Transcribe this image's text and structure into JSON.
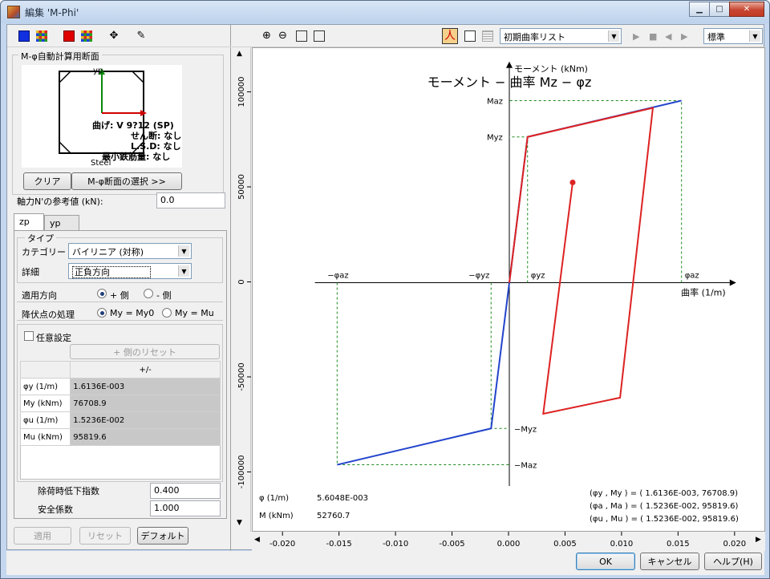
{
  "window": {
    "title": "編集 'M-Phi'"
  },
  "left_toolbar": {
    "icons": [
      "blue-square-icon",
      "grid-icon",
      "red-square-icon",
      "grid-icon",
      "move-icon",
      "draw-icon"
    ]
  },
  "section": {
    "title": "M-φ自動計算用断面",
    "yp_label": "yp",
    "info_lines": [
      "曲げ: V 9?12 (SP)",
      "せん断: なし",
      "L.S.D: なし",
      "最小鉄筋量: なし"
    ],
    "material": "Steel",
    "clear_label": "クリア",
    "select_label": "M-φ断面の選択 >>"
  },
  "axial": {
    "label": "軸力N'の参考値 (kN):",
    "value": "0.0"
  },
  "tabs": [
    "zp",
    "yp"
  ],
  "type_group": {
    "title": "タイプ",
    "category_label": "カテゴリー",
    "category_value": "バイリニア (対称)",
    "detail_label": "詳細",
    "detail_value": "正負方向"
  },
  "direction": {
    "label": "適用方向",
    "options": [
      "+ 側",
      "- 側"
    ],
    "selected": 0
  },
  "yield": {
    "label": "降伏点の処理",
    "options": [
      "My = My0",
      "My = Mu"
    ],
    "selected": 0
  },
  "arbitrary": {
    "label": "任意設定",
    "reset_label": "+ 側のリセット",
    "col_header": "+/-",
    "rows": [
      {
        "label": "φy (1/m)",
        "value": "1.6136E-003"
      },
      {
        "label": "My (kNm)",
        "value": "76708.9"
      },
      {
        "label": "φu (1/m)",
        "value": "1.5236E-002"
      },
      {
        "label": "Mu (kNm)",
        "value": "95819.6"
      }
    ]
  },
  "unloading": {
    "label": "除荷時低下指数",
    "value": "0.400"
  },
  "safety": {
    "label": "安全係数",
    "value": "1.000"
  },
  "left_buttons": {
    "apply": "適用",
    "reset": "リセット",
    "default": "デフォルト"
  },
  "right_toolbar": {
    "curve_list": "初期曲率リスト",
    "view_mode": "標準"
  },
  "chart_data": {
    "type": "line",
    "title": "モーメント − 曲率 Mz − φz",
    "xlabel": "曲率 (1/m)",
    "ylabel": "モーメント (kNm)",
    "xlim": [
      -0.022,
      0.022
    ],
    "ylim": [
      -115000,
      115000
    ],
    "x_ticks": [
      -0.02,
      -0.015,
      -0.01,
      -0.005,
      0.0,
      0.005,
      0.01,
      0.015,
      0.02
    ],
    "x_tick_labels": [
      "-0.020",
      "-0.015",
      "-0.010",
      "-0.005",
      "0.000",
      "0.005",
      "0.010",
      "0.015",
      "0.020"
    ],
    "y_ticks": [
      100000,
      50000,
      0,
      -50000,
      -100000
    ],
    "y_tick_labels": [
      "100000",
      "50000",
      "0",
      "-50000",
      "-100000"
    ],
    "series": [
      {
        "color": "#2244cc",
        "points": [
          [
            0.0,
            0.0
          ],
          [
            -0.0016136,
            -76708.9
          ],
          [
            -0.015236,
            -95819.6
          ]
        ]
      },
      {
        "color": "#2244cc",
        "points": [
          [
            0.0,
            0.0
          ],
          [
            0.0016136,
            76708.9
          ],
          [
            0.015236,
            95819.6
          ]
        ]
      },
      {
        "color": "#dd2222",
        "points": [
          [
            0.0,
            0.0
          ],
          [
            0.0016136,
            76708.9
          ],
          [
            0.0127,
            92000
          ],
          [
            0.0098,
            -60500
          ],
          [
            0.003,
            -69000
          ],
          [
            0.0056048,
            52760.7
          ]
        ]
      }
    ],
    "guide_labels": {
      "maz": "Maz",
      "myz": "Myz",
      "neg_myz": "−Myz",
      "neg_maz": "−Maz",
      "phi_az": "φaz",
      "phi_yz": "φyz",
      "neg_phi_yz": "−φyz",
      "neg_phi_az": "−φaz"
    },
    "readout": {
      "phi_label": "φ (1/m)",
      "phi_value": "5.6048E-003",
      "m_label": "M (kNm)",
      "m_value": "52760.7"
    },
    "summary_lines": [
      "(φy    , My   )  =  ( 1.6136E-003, 76708.9)",
      "(φa    , Ma   )  =  ( 1.5236E-002, 95819.6)",
      "(φu    , Mu   )  =  ( 1.5236E-002, 95819.6)"
    ]
  },
  "dialog_buttons": {
    "ok": "OK",
    "cancel": "キャンセル",
    "help": "ヘルプ(H)"
  }
}
